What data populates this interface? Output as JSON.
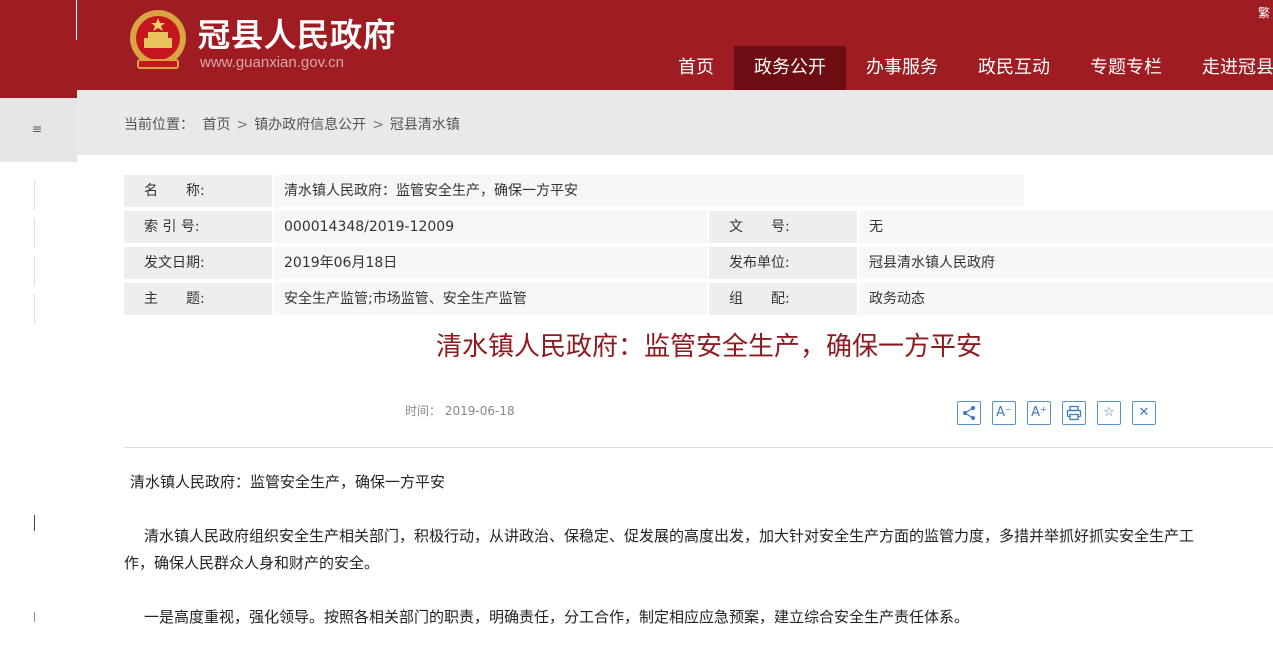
{
  "header": {
    "site_title": "冠县人民政府",
    "site_url": "www.guanxian.gov.cn",
    "lang_toggle": "繁",
    "brand_color": "#9e1c22",
    "nav": [
      {
        "label": "首页",
        "active": false
      },
      {
        "label": "政务公开",
        "active": true
      },
      {
        "label": "办事服务",
        "active": false
      },
      {
        "label": "政民互动",
        "active": false
      },
      {
        "label": "专题专栏",
        "active": false
      },
      {
        "label": "走进冠县",
        "active": false
      }
    ]
  },
  "left_strip": {
    "mark": "≡"
  },
  "breadcrumb": {
    "prefix": "当前位置：",
    "items": [
      "首页",
      "镇办政府信息公开",
      "冠县清水镇"
    ],
    "separator": ">"
  },
  "info": {
    "name_label": "名　　称:",
    "name_value": "清水镇人民政府：监管安全生产，确保一方平安",
    "index_label": "索 引 号:",
    "index_value": "000014348/2019-12009",
    "doc_no_label": "文　　号:",
    "doc_no_value": "无",
    "date_label": "发文日期:",
    "date_value": "2019年06月18日",
    "unit_label": "发布单位:",
    "unit_value": "冠县清水镇人民政府",
    "topic_label": "主　　题:",
    "topic_value": "安全生产监管;市场监管、安全生产监管",
    "group_label": "组　　配:",
    "group_value": "政务动态"
  },
  "article": {
    "title": "清水镇人民政府：监管安全生产，确保一方平安",
    "time_label": "时间：",
    "time_value": "2019-06-18",
    "tools": [
      {
        "icon": "share-icon",
        "glyph": "<"
      },
      {
        "icon": "font-decrease-icon",
        "glyph": "A⁻"
      },
      {
        "icon": "font-increase-icon",
        "glyph": "A⁺"
      },
      {
        "icon": "print-icon",
        "glyph": "⎙"
      },
      {
        "icon": "favorite-icon",
        "glyph": "☆"
      },
      {
        "icon": "close-icon",
        "glyph": "✕"
      }
    ],
    "paragraphs": [
      "清水镇人民政府：监管安全生产，确保一方平安",
      "清水镇人民政府组织安全生产相关部门，积极行动，从讲政治、保稳定、促发展的高度出发，加大针对安全生产方面的监管力度，多措并举抓好抓实安全生产工",
      "作，确保人民群众人身和财产的安全。",
      "一是高度重视，强化领导。按照各相关部门的职责，明确责任，分工合作，制定相应应急预案，建立综合安全生产责任体系。"
    ]
  }
}
